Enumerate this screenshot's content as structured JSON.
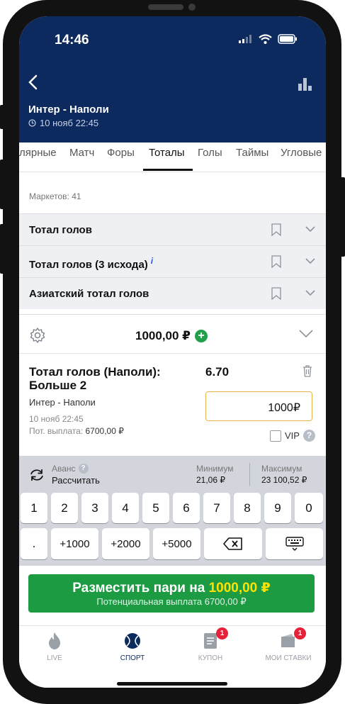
{
  "status": {
    "time": "14:46"
  },
  "header": {
    "title": "Интер - Наполи",
    "datetime": "10 нояб 22:45"
  },
  "tabs": [
    {
      "label": "лярные"
    },
    {
      "label": "Матч"
    },
    {
      "label": "Форы"
    },
    {
      "label": "Тоталы",
      "active": true
    },
    {
      "label": "Голы"
    },
    {
      "label": "Таймы"
    },
    {
      "label": "Угловые"
    }
  ],
  "markets": {
    "count_label": "Маркетов: 41",
    "items": [
      {
        "label": "Тотал голов"
      },
      {
        "label": "Тотал голов (3 исхода)",
        "info": "i"
      },
      {
        "label": "Азиатский тотал голов"
      }
    ]
  },
  "slip": {
    "stake": "1000,00 ₽",
    "plus": "+",
    "bet_title": "Тотал голов (Наполи): Больше 2",
    "odds": "6.70",
    "match": "Интер - Наполи",
    "date": "10 нояб 22:45",
    "payout_label": "Пот. выплата:",
    "payout_value": "6700,00 ₽",
    "amount": "1000₽",
    "vip_label": "VIP",
    "vip_help": "?"
  },
  "keypad": {
    "avans_label": "Аванс",
    "avans_help": "?",
    "recalc_label": "Рассчитать",
    "min_label": "Минимум",
    "min_value": "21,06 ₽",
    "max_label": "Максимум",
    "max_value": "23 100,52 ₽",
    "digits": [
      "1",
      "2",
      "3",
      "4",
      "5",
      "6",
      "7",
      "8",
      "9",
      "0"
    ],
    "dot": ".",
    "quick": [
      "+1000",
      "+2000",
      "+5000"
    ]
  },
  "place_bet": {
    "label": "Разместить пари на",
    "amount": "1000,00 ₽",
    "sub": "Потенциальная выплата 6700,00 ₽"
  },
  "nav": {
    "items": [
      {
        "label": "LIVE"
      },
      {
        "label": "СПОРТ",
        "active": true
      },
      {
        "label": "КУПОН",
        "badge": "1"
      },
      {
        "label": "МОИ СТАВКИ",
        "badge": "1"
      }
    ]
  },
  "colors": {
    "header_bg": "#0d2a5e",
    "accent_green": "#1c9b43",
    "amount_yellow": "#ffe100",
    "badge_red": "#e8213a",
    "input_border": "#e8b24a"
  }
}
